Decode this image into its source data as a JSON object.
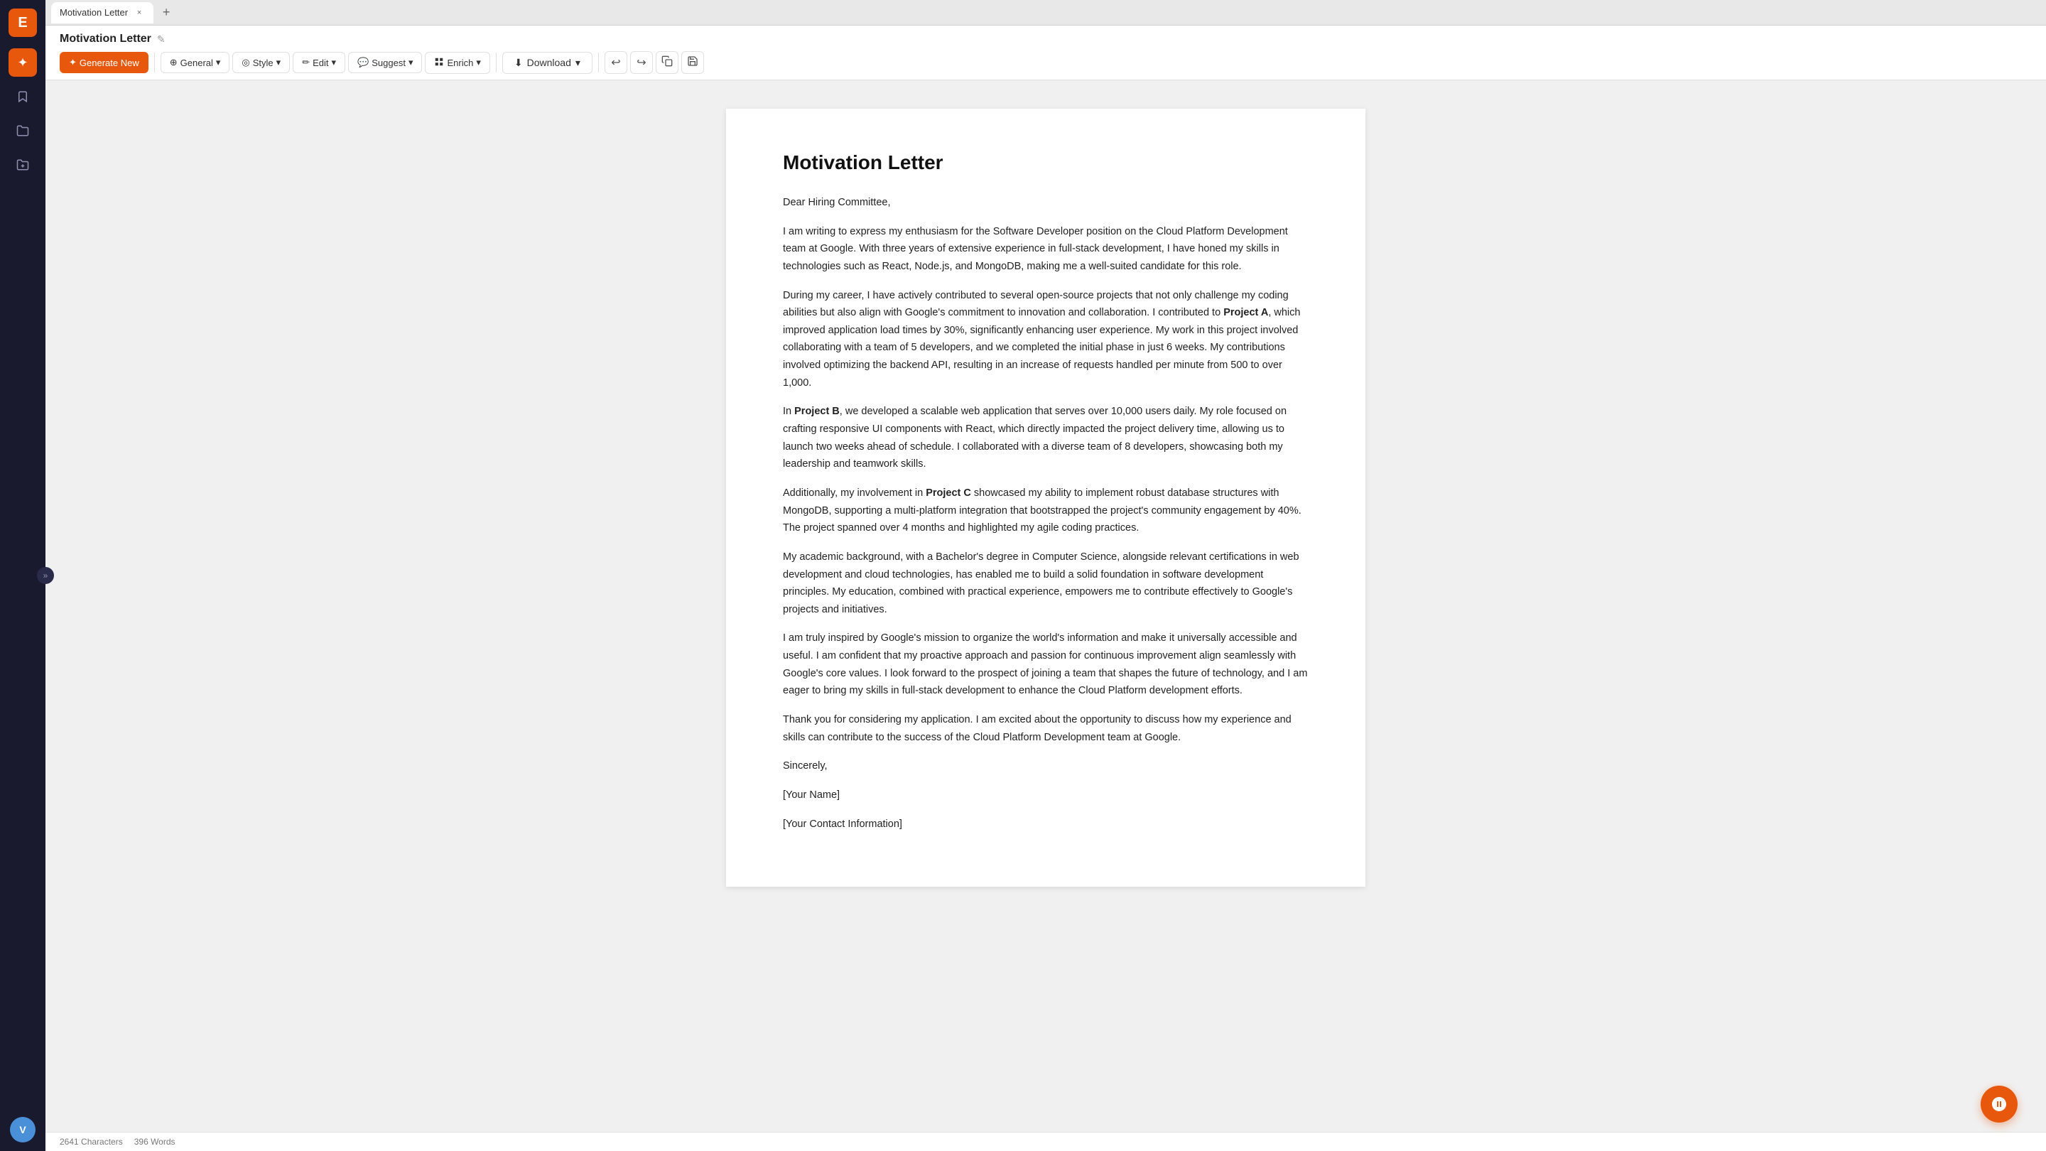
{
  "sidebar": {
    "logo_text": "E",
    "items": [
      {
        "id": "star",
        "icon": "✦",
        "active": true
      },
      {
        "id": "bookmark",
        "icon": "🔖",
        "active": false
      },
      {
        "id": "folder1",
        "icon": "📁",
        "active": false
      },
      {
        "id": "folder2",
        "icon": "📂",
        "active": false
      }
    ],
    "avatar_text": "V",
    "collapse_icon": "»"
  },
  "tab_bar": {
    "tab_label": "Motivation Letter",
    "close_icon": "×",
    "add_icon": "+"
  },
  "header": {
    "doc_title": "Motivation Letter",
    "edit_icon": "✎",
    "toolbar": {
      "generate_label": "Generate New",
      "generate_icon": "✦",
      "general_label": "General",
      "general_icon": "⊕",
      "chevron": "▾",
      "style_label": "Style",
      "style_icon": "◎",
      "edit_label": "Edit",
      "edit_icon": "✏",
      "suggest_label": "Suggest",
      "suggest_icon": "💬",
      "enrich_label": "Enrich",
      "enrich_icon": "⬛",
      "download_label": "Download",
      "download_icon": "⬇",
      "undo_icon": "↩",
      "redo_icon": "↪",
      "copy_icon": "⧉",
      "save_icon": "💾"
    }
  },
  "document": {
    "title": "Motivation Letter",
    "greeting": "Dear Hiring Committee,",
    "paragraph1": "I am writing to express my enthusiasm for the Software Developer position on the Cloud Platform Development team at Google. With three years of extensive experience in full-stack development, I have honed my skills in technologies such as React, Node.js, and MongoDB, making me a well-suited candidate for this role.",
    "paragraph2_before": "During my career, I have actively contributed to several open-source projects that not only challenge my coding abilities but also align with Google's commitment to innovation and collaboration. I contributed to ",
    "project_a": "Project A",
    "paragraph2_after": ", which improved application load times by 30%, significantly enhancing user experience. My work in this project involved collaborating with a team of 5 developers, and we completed the initial phase in just 6 weeks. My contributions involved optimizing the backend API, resulting in an increase of requests handled per minute from 500 to over 1,000.",
    "paragraph3_before": "In ",
    "project_b": "Project B",
    "paragraph3_after": ", we developed a scalable web application that serves over 10,000 users daily. My role focused on crafting responsive UI components with React, which directly impacted the project delivery time, allowing us to launch two weeks ahead of schedule. I collaborated with a diverse team of 8 developers, showcasing both my leadership and teamwork skills.",
    "paragraph4_before": "Additionally, my involvement in ",
    "project_c": "Project C",
    "paragraph4_after": " showcased my ability to implement robust database structures with MongoDB, supporting a multi-platform integration that bootstrapped the project's community engagement by 40%. The project spanned over 4 months and highlighted my agile coding practices.",
    "paragraph5": "My academic background, with a Bachelor's degree in Computer Science, alongside relevant certifications in web development and cloud technologies, has enabled me to build a solid foundation in software development principles. My education, combined with practical experience, empowers me to contribute effectively to Google's projects and initiatives.",
    "paragraph6": "I am truly inspired by Google's mission to organize the world's information and make it universally accessible and useful. I am confident that my proactive approach and passion for continuous improvement align seamlessly with Google's core values. I look forward to the prospect of joining a team that shapes the future of technology, and I am eager to bring my skills in full-stack development to enhance the Cloud Platform development efforts.",
    "paragraph7": "Thank you for considering my application. I am excited about the opportunity to discuss how my experience and skills can contribute to the success of the Cloud Platform Development team at Google.",
    "closing": "Sincerely,",
    "name": "[Your Name]",
    "contact": "[Your Contact Information]"
  },
  "status_bar": {
    "characters_label": "2641 Characters",
    "words_label": "396 Words"
  }
}
